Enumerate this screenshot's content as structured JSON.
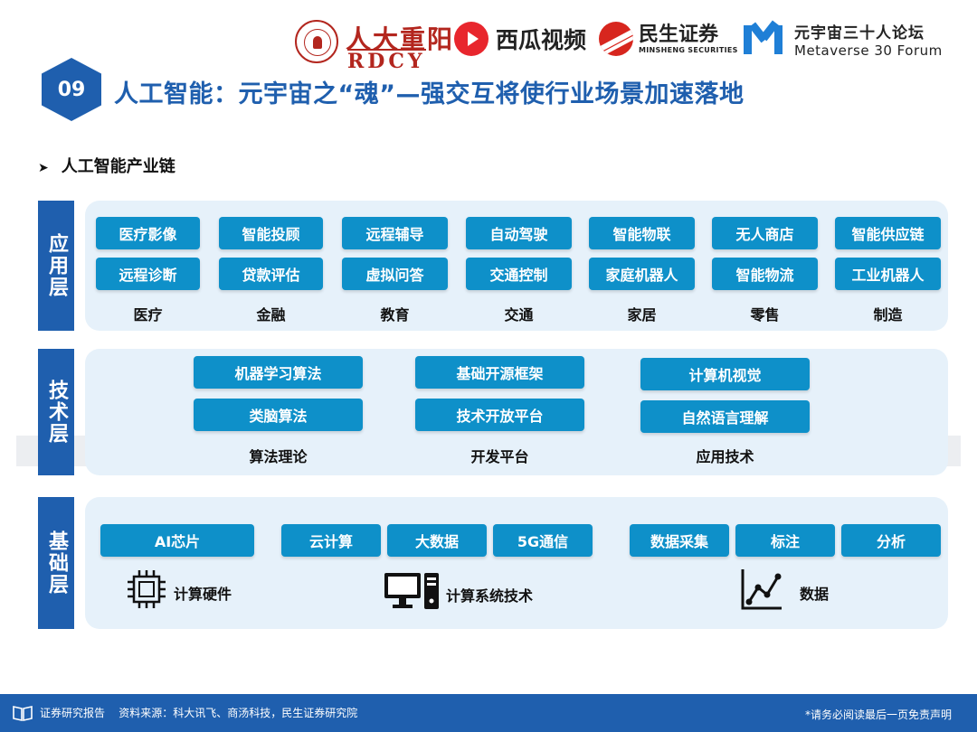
{
  "header": {
    "logo_rdcy_cn": "人大重阳",
    "logo_rdcy_en": "RDCY",
    "logo_xigua": "西瓜视频",
    "logo_minsheng_cn": "民生证券",
    "logo_minsheng_en": "MINSHENG SECURITIES",
    "logo_forum_cn": "元宇宙三十人论坛",
    "logo_forum_en": "Metaverse 30 Forum"
  },
  "title": {
    "number": "09",
    "text": "人工智能：元宇宙之“魂”—强交互将使行业场景加速落地"
  },
  "subhead": "人工智能产业链",
  "layers": {
    "application": {
      "label": "应用层",
      "top_row": [
        "医疗影像",
        "智能投顾",
        "远程辅导",
        "自动驾驶",
        "智能物联",
        "无人商店",
        "智能供应链"
      ],
      "bottom_row": [
        "远程诊断",
        "贷款评估",
        "虚拟问答",
        "交通控制",
        "家庭机器人",
        "智能物流",
        "工业机器人"
      ],
      "categories": [
        "医疗",
        "金融",
        "教育",
        "交通",
        "家居",
        "零售",
        "制造"
      ]
    },
    "technology": {
      "label": "技术层",
      "groups": [
        {
          "items": [
            "机器学习算法",
            "类脑算法"
          ],
          "category": "算法理论"
        },
        {
          "items": [
            "基础开源框架",
            "技术开放平台"
          ],
          "category": "开发平台"
        },
        {
          "items": [
            "计算机视觉",
            "自然语言理解"
          ],
          "category": "应用技术"
        }
      ]
    },
    "foundation": {
      "label": "基础层",
      "hardware": {
        "items": [
          "AI芯片"
        ],
        "category": "计算硬件",
        "icon": "chip-icon"
      },
      "system": {
        "items": [
          "云计算",
          "大数据",
          "5G通信"
        ],
        "category": "计算系统技术",
        "icon": "computer-icon"
      },
      "data": {
        "items": [
          "数据采集",
          "标注",
          "分析"
        ],
        "category": "数据",
        "icon": "line-graph-icon"
      }
    }
  },
  "footer": {
    "left": "证券研究报告    资料来源：科大讯飞、商汤科技，民生证券研究院",
    "right": "*请务必阅读最后一页免责声明"
  },
  "colors": {
    "primary": "#1f5fae",
    "button": "#0e90c9",
    "panel": "#e6f1fa"
  }
}
